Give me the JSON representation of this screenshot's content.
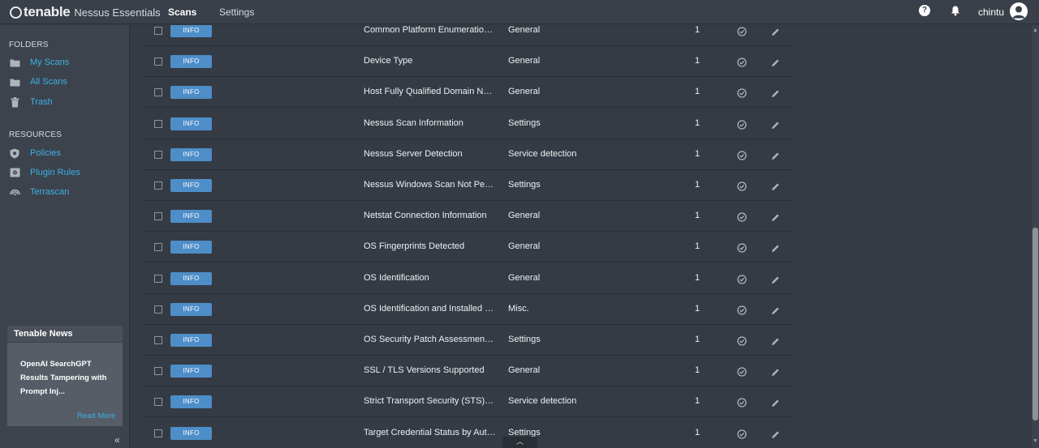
{
  "app": {
    "brand": "tenable",
    "product": "Nessus Essentials",
    "nav": [
      {
        "label": "Scans",
        "active": true
      },
      {
        "label": "Settings",
        "active": false
      }
    ],
    "username": "chintu",
    "help_glyph": "?"
  },
  "sidebar": {
    "folders_label": "FOLDERS",
    "folders": [
      {
        "label": "My Scans",
        "icon": "folder-icon"
      },
      {
        "label": "All Scans",
        "icon": "folder-icon"
      },
      {
        "label": "Trash",
        "icon": "trash-icon"
      }
    ],
    "resources_label": "RESOURCES",
    "resources": [
      {
        "label": "Policies",
        "icon": "policy-shield-icon"
      },
      {
        "label": "Plugin Rules",
        "icon": "plugin-rules-icon"
      },
      {
        "label": "Terrascan",
        "icon": "terrascan-icon"
      }
    ],
    "news": {
      "title": "Tenable News",
      "headline": "OpenAI SearchGPT Results Tampering with Prompt Inj...",
      "more": "Read More"
    },
    "collapse_glyph": "«"
  },
  "rows": [
    {
      "severity": "INFO",
      "name": "Common Platform Enumeration (CPE)",
      "family": "General",
      "count": "1"
    },
    {
      "severity": "INFO",
      "name": "Device Type",
      "family": "General",
      "count": "1"
    },
    {
      "severity": "INFO",
      "name": "Host Fully Qualified Domain Name (FQDN) Resolution",
      "family": "General",
      "count": "1"
    },
    {
      "severity": "INFO",
      "name": "Nessus Scan Information",
      "family": "Settings",
      "count": "1"
    },
    {
      "severity": "INFO",
      "name": "Nessus Server Detection",
      "family": "Service detection",
      "count": "1"
    },
    {
      "severity": "INFO",
      "name": "Nessus Windows Scan Not Performed",
      "family": "Settings",
      "count": "1"
    },
    {
      "severity": "INFO",
      "name": "Netstat Connection Information",
      "family": "General",
      "count": "1"
    },
    {
      "severity": "INFO",
      "name": "OS Fingerprints Detected",
      "family": "General",
      "count": "1"
    },
    {
      "severity": "INFO",
      "name": "OS Identification",
      "family": "General",
      "count": "1"
    },
    {
      "severity": "INFO",
      "name": "OS Identification and Installed Software",
      "family": "Misc.",
      "count": "1"
    },
    {
      "severity": "INFO",
      "name": "OS Security Patch Assessment Not Available",
      "family": "Settings",
      "count": "1"
    },
    {
      "severity": "INFO",
      "name": "SSL / TLS Versions Supported",
      "family": "General",
      "count": "1"
    },
    {
      "severity": "INFO",
      "name": "Strict Transport Security (STS) Detection",
      "family": "Service detection",
      "count": "1"
    },
    {
      "severity": "INFO",
      "name": "Target Credential Status by Authentication Protocol",
      "family": "Settings",
      "count": "1"
    }
  ],
  "colors": {
    "accent": "#3fb0e6",
    "info_badge": "#4e8ec8",
    "topbar": "#3a4049",
    "sidebar": "#3c434d",
    "content": "#353b44"
  }
}
